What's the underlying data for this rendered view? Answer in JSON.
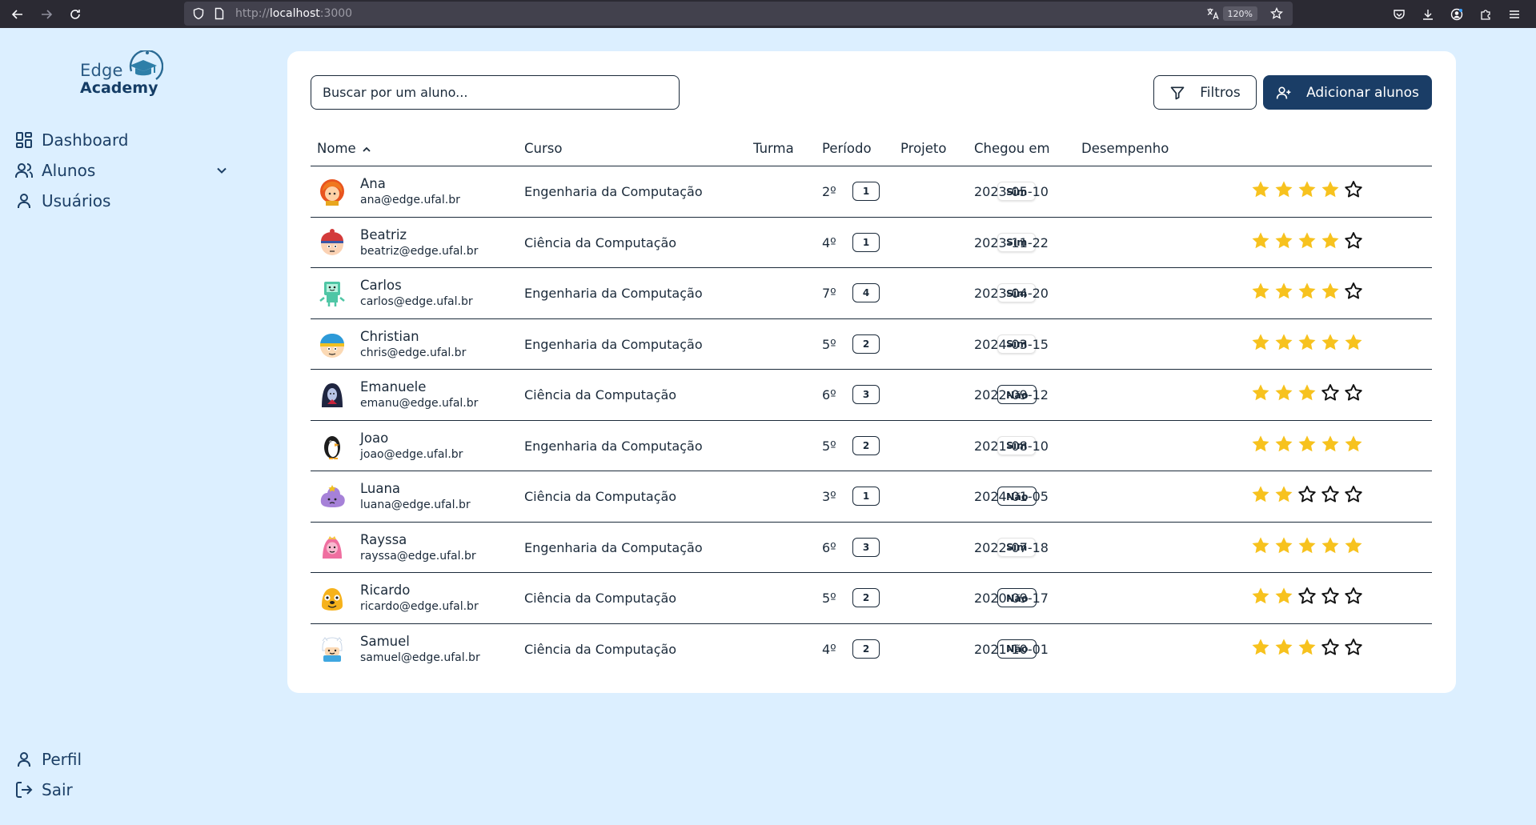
{
  "browser": {
    "url_prefix": "http://",
    "url_host": "localhost",
    "url_port": ":3000",
    "zoom": "120%"
  },
  "sidebar": {
    "logo_top": "Edge",
    "logo_bottom": "Academy",
    "items": [
      {
        "label": "Dashboard",
        "icon": "dashboard-icon"
      },
      {
        "label": "Alunos",
        "icon": "users-icon"
      },
      {
        "label": "Usuários",
        "icon": "user-icon"
      }
    ],
    "bottom_items": [
      {
        "label": "Perfil",
        "icon": "user-icon"
      },
      {
        "label": "Sair",
        "icon": "logout-icon"
      }
    ]
  },
  "toolbar": {
    "search_placeholder": "Buscar por um aluno...",
    "filter_label": "Filtros",
    "add_label": "Adicionar alunos"
  },
  "table": {
    "headers": {
      "nome": "Nome",
      "curso": "Curso",
      "turma": "Turma",
      "periodo": "Período",
      "projeto": "Projeto",
      "chegou": "Chegou em",
      "desempenho": "Desempenho"
    },
    "rows": [
      {
        "name": "Ana",
        "email": "ana@edge.ufal.br",
        "course": "Engenharia da Computação",
        "turma": "1",
        "periodo": "2º",
        "projeto": "Sim",
        "chegou": "2023-05-10",
        "rating": 4,
        "avatar": "red-hair"
      },
      {
        "name": "Beatriz",
        "email": "beatriz@edge.ufal.br",
        "course": "Ciência da Computação",
        "turma": "1",
        "periodo": "4º",
        "projeto": "Sim",
        "chegou": "2023-11-22",
        "rating": 4,
        "avatar": "hat-kid"
      },
      {
        "name": "Carlos",
        "email": "carlos@edge.ufal.br",
        "course": "Engenharia da Computação",
        "turma": "4",
        "periodo": "7º",
        "projeto": "Sim",
        "chegou": "2023-04-20",
        "rating": 4,
        "avatar": "robot"
      },
      {
        "name": "Christian",
        "email": "chris@edge.ufal.br",
        "course": "Engenharia da Computação",
        "turma": "2",
        "periodo": "5º",
        "projeto": "Sim",
        "chegou": "2024-03-15",
        "rating": 5,
        "avatar": "cap-kid"
      },
      {
        "name": "Emanuele",
        "email": "emanu@edge.ufal.br",
        "course": "Ciência da Computação",
        "turma": "3",
        "periodo": "6º",
        "projeto": "Não",
        "chegou": "2022-09-12",
        "rating": 3,
        "avatar": "vampire"
      },
      {
        "name": "Joao",
        "email": "joao@edge.ufal.br",
        "course": "Engenharia da Computação",
        "turma": "2",
        "periodo": "5º",
        "projeto": "Sim",
        "chegou": "2021-08-10",
        "rating": 5,
        "avatar": "penguin"
      },
      {
        "name": "Luana",
        "email": "luana@edge.ufal.br",
        "course": "Ciência da Computação",
        "turma": "1",
        "periodo": "3º",
        "projeto": "Não",
        "chegou": "2024-01-05",
        "rating": 2,
        "avatar": "lumpy"
      },
      {
        "name": "Rayssa",
        "email": "rayssa@edge.ufal.br",
        "course": "Engenharia da Computação",
        "turma": "3",
        "periodo": "6º",
        "projeto": "Sim",
        "chegou": "2022-07-18",
        "rating": 5,
        "avatar": "pink-princess"
      },
      {
        "name": "Ricardo",
        "email": "ricardo@edge.ufal.br",
        "course": "Ciência da Computação",
        "turma": "2",
        "periodo": "5º",
        "projeto": "Não",
        "chegou": "2020-09-17",
        "rating": 2,
        "avatar": "yellow-dog"
      },
      {
        "name": "Samuel",
        "email": "samuel@edge.ufal.br",
        "course": "Ciência da Computação",
        "turma": "2",
        "periodo": "4º",
        "projeto": "Não",
        "chegou": "2021-10-01",
        "rating": 3,
        "avatar": "white-hat"
      }
    ]
  },
  "colors": {
    "background": "#dcefff",
    "primary": "#1a3d66",
    "star": "#f7c21e"
  }
}
